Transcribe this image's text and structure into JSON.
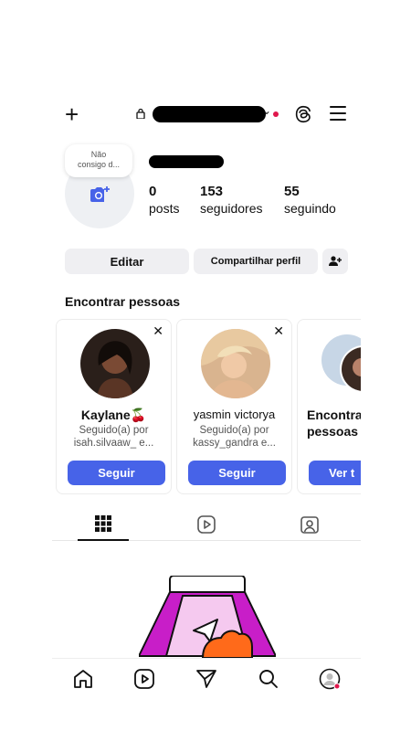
{
  "topbar": {
    "new_icon": "plus-icon",
    "lock_icon": "lock-icon",
    "threads_icon": "threads-icon",
    "menu_icon": "hamburger-menu-icon",
    "notification_color": "#e0174c"
  },
  "profile": {
    "note": [
      "Não",
      "consigo d..."
    ],
    "avatar_icon": "add-photo-icon",
    "stats": [
      {
        "value": "0",
        "label": "posts"
      },
      {
        "value": "153",
        "label": "seguidores"
      },
      {
        "value": "55",
        "label": "seguindo"
      }
    ]
  },
  "actions": {
    "edit": "Editar",
    "share": "Compartilhar perfil",
    "add_user_icon": "add-user-icon"
  },
  "suggestions": {
    "title": "Encontrar pessoas",
    "cards": [
      {
        "name": "Kaylane🍒",
        "line1": "Seguido(a) por",
        "line2": "isah.silvaaw_ e...",
        "button": "Seguir"
      },
      {
        "name": "yasmin victorya",
        "line1": "Seguido(a) por",
        "line2": "kassy_gandra e...",
        "button": "Seguir"
      },
      {
        "name": "Encontra",
        "name2": "pessoas",
        "button": "Ver t"
      }
    ]
  },
  "tabs": [
    {
      "icon": "grid-icon"
    },
    {
      "icon": "reels-icon"
    },
    {
      "icon": "tagged-icon"
    }
  ],
  "bottom_nav": [
    {
      "icon": "home-icon"
    },
    {
      "icon": "reels-icon"
    },
    {
      "icon": "send-icon"
    },
    {
      "icon": "search-icon"
    },
    {
      "icon": "profile-icon"
    }
  ],
  "colors": {
    "accent": "#4763e8",
    "button_bg": "#efeff2",
    "illustration_magenta": "#c81ec8",
    "illustration_orange": "#ff6a1a"
  }
}
